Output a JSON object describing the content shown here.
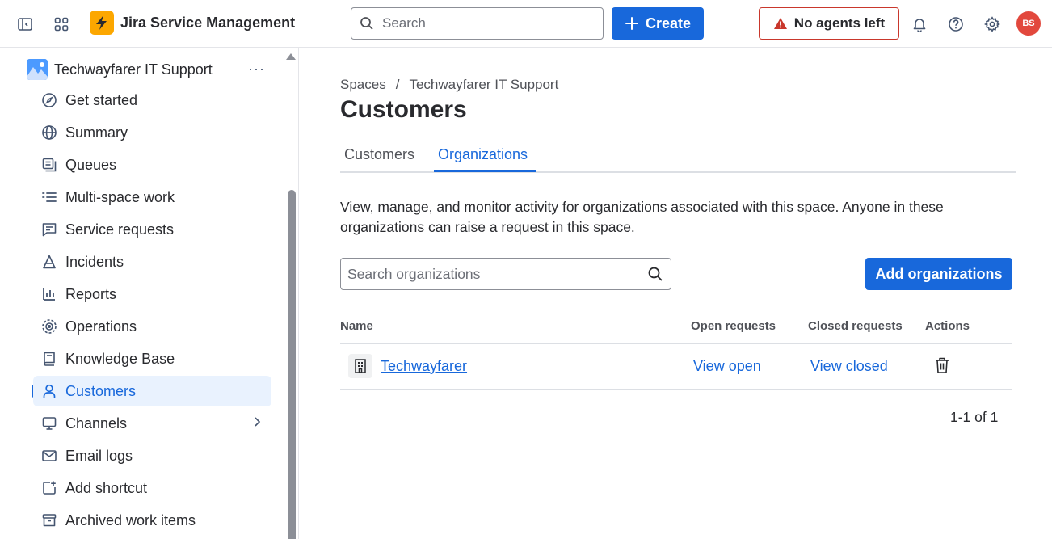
{
  "topbar": {
    "app_name": "Jira Service Management",
    "search_placeholder": "Search",
    "create_label": "Create",
    "agents_label": "No agents left",
    "avatar_initials": "BS",
    "accent": "#1868db",
    "warning_color": "#c9372c"
  },
  "sidebar": {
    "space_name": "Techwayfarer IT Support",
    "space_more": "···",
    "items": [
      {
        "label": "Get started",
        "icon": "compass-icon"
      },
      {
        "label": "Summary",
        "icon": "globe-icon"
      },
      {
        "label": "Queues",
        "icon": "queues-icon"
      },
      {
        "label": "Multi-space work",
        "icon": "list-icon"
      },
      {
        "label": "Service requests",
        "icon": "chat-icon"
      },
      {
        "label": "Incidents",
        "icon": "incident-icon"
      },
      {
        "label": "Reports",
        "icon": "chart-icon"
      },
      {
        "label": "Operations",
        "icon": "operations-icon"
      },
      {
        "label": "Knowledge Base",
        "icon": "book-icon"
      },
      {
        "label": "Customers",
        "icon": "person-icon",
        "active": true
      },
      {
        "label": "Channels",
        "icon": "monitor-icon",
        "has_chevron": true
      },
      {
        "label": "Email logs",
        "icon": "mail-icon"
      },
      {
        "label": "Add shortcut",
        "icon": "add-shortcut-icon"
      },
      {
        "label": "Archived work items",
        "icon": "archive-icon"
      }
    ]
  },
  "main": {
    "breadcrumb": [
      "Spaces",
      "/",
      "Techwayfarer IT Support"
    ],
    "title": "Customers",
    "tabs": [
      {
        "label": "Customers",
        "selected": false
      },
      {
        "label": "Organizations",
        "selected": true
      }
    ],
    "description": "View, manage, and monitor activity for organizations associated with this space. Anyone in these organizations can raise a request in this space.",
    "org_search_placeholder": "Search organizations",
    "add_button_label": "Add organizations",
    "table": {
      "columns": [
        "Name",
        "Open requests",
        "Closed requests",
        "Actions"
      ],
      "rows": [
        {
          "name": "Techwayfarer",
          "open": "View open",
          "closed": "View closed"
        }
      ]
    },
    "pagination": "1-1 of 1"
  }
}
